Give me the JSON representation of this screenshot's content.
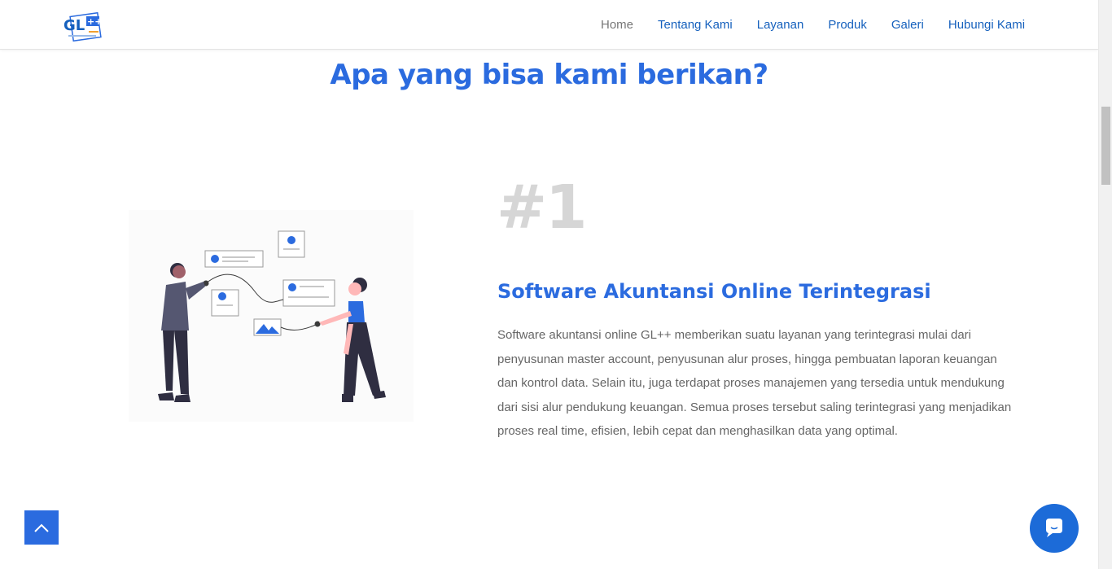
{
  "header": {
    "logo_text": "GL++",
    "nav": [
      {
        "label": "Home",
        "active": true
      },
      {
        "label": "Tentang Kami"
      },
      {
        "label": "Layanan"
      },
      {
        "label": "Produk"
      },
      {
        "label": "Galeri"
      },
      {
        "label": "Hubungi Kami"
      }
    ]
  },
  "section": {
    "title": "Apa yang bisa kami berikan?"
  },
  "feature": {
    "number": "#1",
    "title": "Software Akuntansi Online Terintegrasi",
    "description": "Software akuntansi online GL++ memberikan suatu layanan yang terintegrasi mulai dari penyusunan master account, penyusunan alur proses, hingga pembuatan laporan keuangan dan kontrol data. Selain itu, juga terdapat proses manajemen yang tersedia untuk mendukung dari sisi alur pendukung keuangan. Semua proses tersebut saling terintegrasi yang menjadikan proses real time, efisien, lebih cepat dan menghasilkan data yang optimal."
  },
  "colors": {
    "accent": "#2b6bdf",
    "nav_link": "#1560bd",
    "number_gray": "#d6d6d6"
  },
  "icons": {
    "back_to_top": "chevron-up-icon",
    "chat": "chat-bubble-icon"
  }
}
